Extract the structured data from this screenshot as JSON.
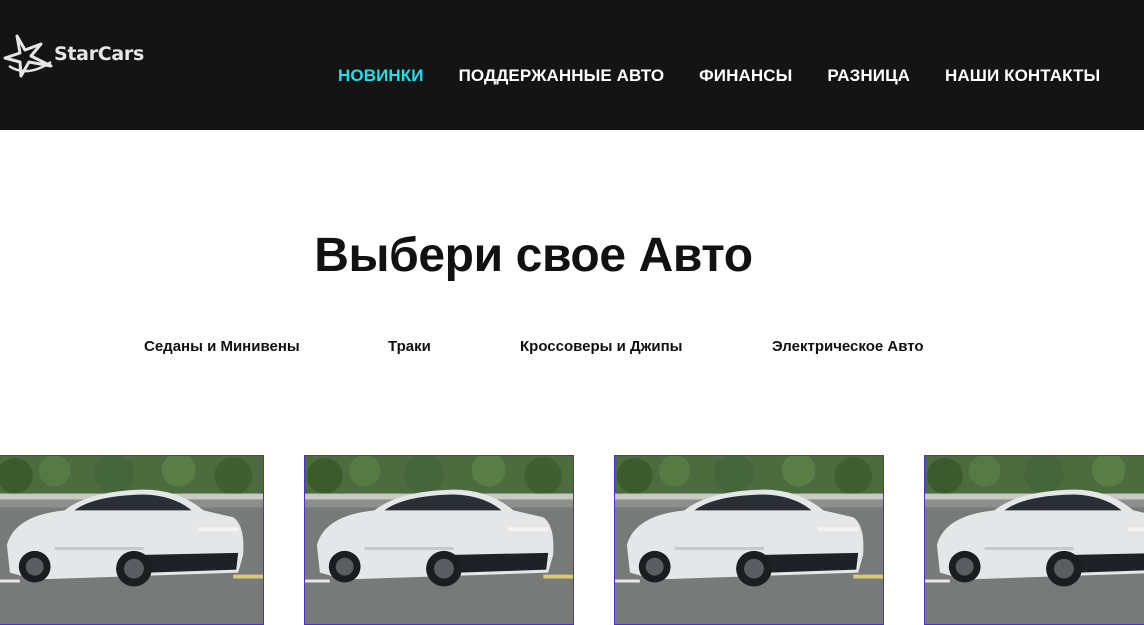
{
  "header": {
    "logo_text": "StarCars",
    "nav": [
      {
        "label": "НОВИНКИ",
        "active": true
      },
      {
        "label": "ПОДДЕРЖАННЫЕ АВТО",
        "active": false
      },
      {
        "label": "ФИНАНСЫ",
        "active": false
      },
      {
        "label": "РАЗНИЦА",
        "active": false
      },
      {
        "label": "НАШИ КОНТАКТЫ",
        "active": false
      }
    ]
  },
  "main": {
    "title": "Выбери свое Авто",
    "tabs": [
      {
        "label": "Седаны и Минивены"
      },
      {
        "label": "Траки"
      },
      {
        "label": "Кроссоверы и Джипы"
      },
      {
        "label": "Электрическое Авто"
      }
    ],
    "cards": [
      {
        "image": "white-crossover-sedan-photo"
      },
      {
        "image": "white-crossover-sedan-photo"
      },
      {
        "image": "white-crossover-sedan-photo"
      },
      {
        "image": "white-crossover-sedan-photo"
      }
    ]
  },
  "colors": {
    "header_bg": "#141414",
    "nav_active": "#22e0ea",
    "nav_text": "#ffffff",
    "card_border": "#4b2fd1"
  }
}
